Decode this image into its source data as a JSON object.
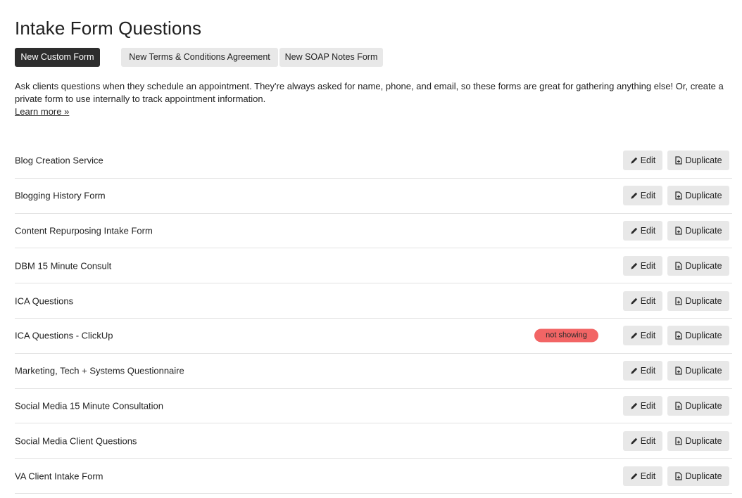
{
  "page": {
    "title": "Intake Form Questions",
    "description": "Ask clients questions when they schedule an appointment. They're always asked for name, phone, and email, so these forms are great for gathering anything else! Or, create a private form to use internally to track appointment information.",
    "learn_more": "Learn more »"
  },
  "toolbar": {
    "new_custom_form": "New Custom Form",
    "new_terms": "New Terms & Conditions Agreement",
    "new_soap": "New SOAP Notes Form"
  },
  "actions": {
    "edit_label": "Edit",
    "duplicate_label": "Duplicate",
    "edit_icon": "pencil-icon",
    "duplicate_icon": "copy-file-icon"
  },
  "colors": {
    "primary_button": "#2d2d2d",
    "secondary_button": "#e8e8e8",
    "badge_red": "#f26565"
  },
  "forms": [
    {
      "name": "Blog Creation Service",
      "badge": ""
    },
    {
      "name": "Blogging History Form",
      "badge": ""
    },
    {
      "name": "Content Repurposing Intake Form",
      "badge": ""
    },
    {
      "name": "DBM 15 Minute Consult",
      "badge": ""
    },
    {
      "name": "ICA Questions",
      "badge": ""
    },
    {
      "name": "ICA Questions - ClickUp",
      "badge": "not showing"
    },
    {
      "name": "Marketing, Tech + Systems Questionnaire",
      "badge": ""
    },
    {
      "name": "Social Media 15 Minute Consultation",
      "badge": ""
    },
    {
      "name": "Social Media Client Questions",
      "badge": ""
    },
    {
      "name": "VA Client Intake Form",
      "badge": ""
    }
  ]
}
